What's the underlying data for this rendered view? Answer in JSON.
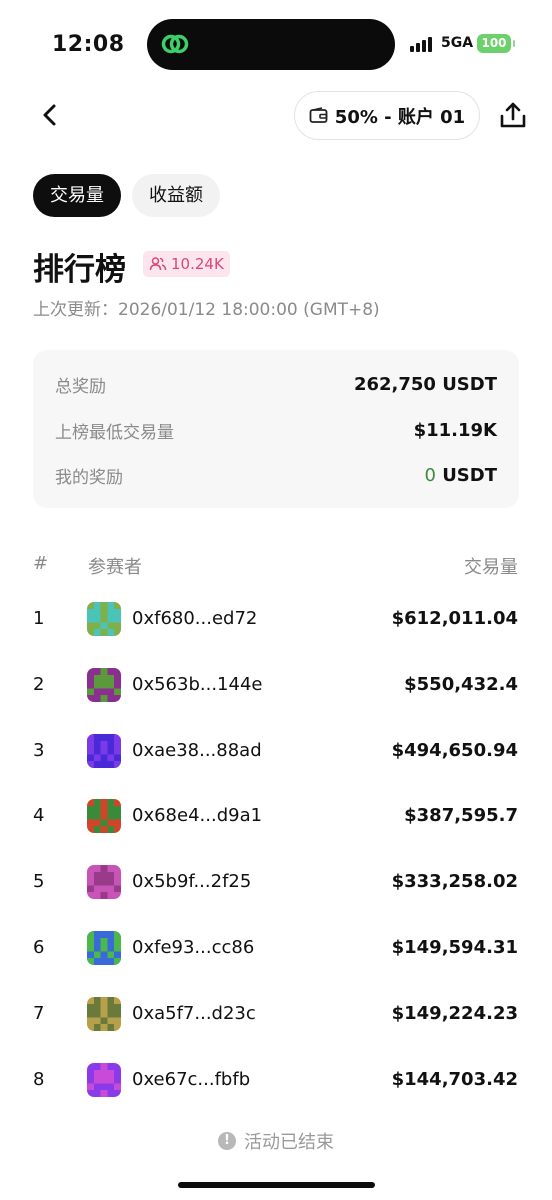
{
  "status_bar": {
    "time": "12:08",
    "network": "5GA",
    "battery": "100"
  },
  "header": {
    "account_label": "50% - 账户 01"
  },
  "tabs": [
    {
      "label": "交易量",
      "active": true
    },
    {
      "label": "收益额",
      "active": false
    }
  ],
  "leaderboard": {
    "title": "排行榜",
    "participants": "10.24K",
    "updated_label": "上次更新：2026/01/12 18:00:00 (GMT+8)"
  },
  "summary": {
    "total_reward_label": "总奖励",
    "total_reward_value": "262,750 USDT",
    "min_volume_label": "上榜最低交易量",
    "min_volume_value": "$11.19K",
    "my_reward_label": "我的奖励",
    "my_reward_amount": "0",
    "my_reward_unit": " USDT"
  },
  "table": {
    "headers": {
      "rank": "#",
      "participant": "参赛者",
      "volume": "交易量"
    },
    "rows": [
      {
        "rank": "1",
        "address": "0xf680...ed72",
        "volume": "$612,011.04",
        "avatar_colors": [
          "#7fb04a",
          "#4ac4b8"
        ]
      },
      {
        "rank": "2",
        "address": "0x563b...144e",
        "volume": "$550,432.4",
        "avatar_colors": [
          "#8a2f8f",
          "#5a9a3a"
        ]
      },
      {
        "rank": "3",
        "address": "0xae38...88ad",
        "volume": "$494,650.94",
        "avatar_colors": [
          "#4a2ad8",
          "#7a3ae8"
        ]
      },
      {
        "rank": "4",
        "address": "0x68e4...d9a1",
        "volume": "$387,595.7",
        "avatar_colors": [
          "#d0452a",
          "#3a8a3a"
        ]
      },
      {
        "rank": "5",
        "address": "0x5b9f...2f25",
        "volume": "$333,258.02",
        "avatar_colors": [
          "#c854b8",
          "#9a3a8a"
        ]
      },
      {
        "rank": "6",
        "address": "0xfe93...cc86",
        "volume": "$149,594.31",
        "avatar_colors": [
          "#3a6ad8",
          "#4ab84a"
        ]
      },
      {
        "rank": "7",
        "address": "0xa5f7...d23c",
        "volume": "$149,224.23",
        "avatar_colors": [
          "#b8a04a",
          "#6a7a3a"
        ]
      },
      {
        "rank": "8",
        "address": "0xe67c...fbfb",
        "volume": "$144,703.42",
        "avatar_colors": [
          "#8a3ae8",
          "#c84ad8"
        ]
      }
    ]
  },
  "footer": {
    "ended_label": "活动已结束"
  },
  "colors": {
    "accent_dark": "#0e0e0e",
    "badge_pink": "#d64a7a",
    "positive_green": "#3f8a3f",
    "muted_gray": "#8a8a8a"
  }
}
